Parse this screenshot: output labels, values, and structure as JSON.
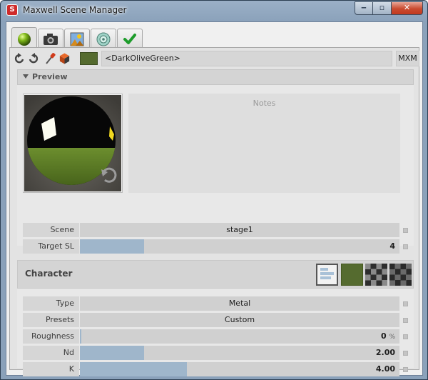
{
  "window": {
    "title": "Maxwell Scene Manager",
    "controls": {
      "minimize": "‒",
      "maximize": "▫",
      "close": "✕"
    }
  },
  "tabs": [
    {
      "name": "material-tab",
      "icon": "green-sphere-icon",
      "active": true
    },
    {
      "name": "camera-tab",
      "icon": "camera-icon",
      "active": false
    },
    {
      "name": "environment-tab",
      "icon": "landscape-icon",
      "active": false
    },
    {
      "name": "render-tab",
      "icon": "disc-icon",
      "active": false
    },
    {
      "name": "output-tab",
      "icon": "checkmark-icon",
      "active": false
    }
  ],
  "toolbar": {
    "icons": [
      "undo-icon",
      "redo-icon",
      "eyedropper-icon",
      "cube-icon"
    ],
    "swatch_color": "#556b2f",
    "material_name": "<DarkOliveGreen>",
    "mxm_label": "MXM"
  },
  "preview": {
    "header": "Preview",
    "notes_placeholder": "Notes",
    "refresh_icon": "refresh-icon"
  },
  "scene": {
    "label": "Scene",
    "value": "stage1"
  },
  "target_sl": {
    "label": "Target SL",
    "value": "4",
    "fill_fraction": 0.2
  },
  "character": {
    "title": "Character",
    "buttons": [
      "layers-icon",
      "color-swatch",
      "checker-map-icon",
      "checker-texture-icon"
    ],
    "color": "#556b2f"
  },
  "properties": {
    "type": {
      "label": "Type",
      "value": "Metal"
    },
    "presets": {
      "label": "Presets",
      "value": "Custom"
    },
    "roughness": {
      "label": "Roughness",
      "value": "0",
      "unit": "%",
      "fill_fraction": 0.005
    },
    "nd": {
      "label": "Nd",
      "value": "2.00",
      "fill_fraction": 0.2
    },
    "k": {
      "label": "K",
      "value": "4.00",
      "fill_fraction": 0.335
    }
  },
  "colors": {
    "accent_fill": "#9fb6cb",
    "material": "#556b2f",
    "close_button": "#c94a2f"
  }
}
